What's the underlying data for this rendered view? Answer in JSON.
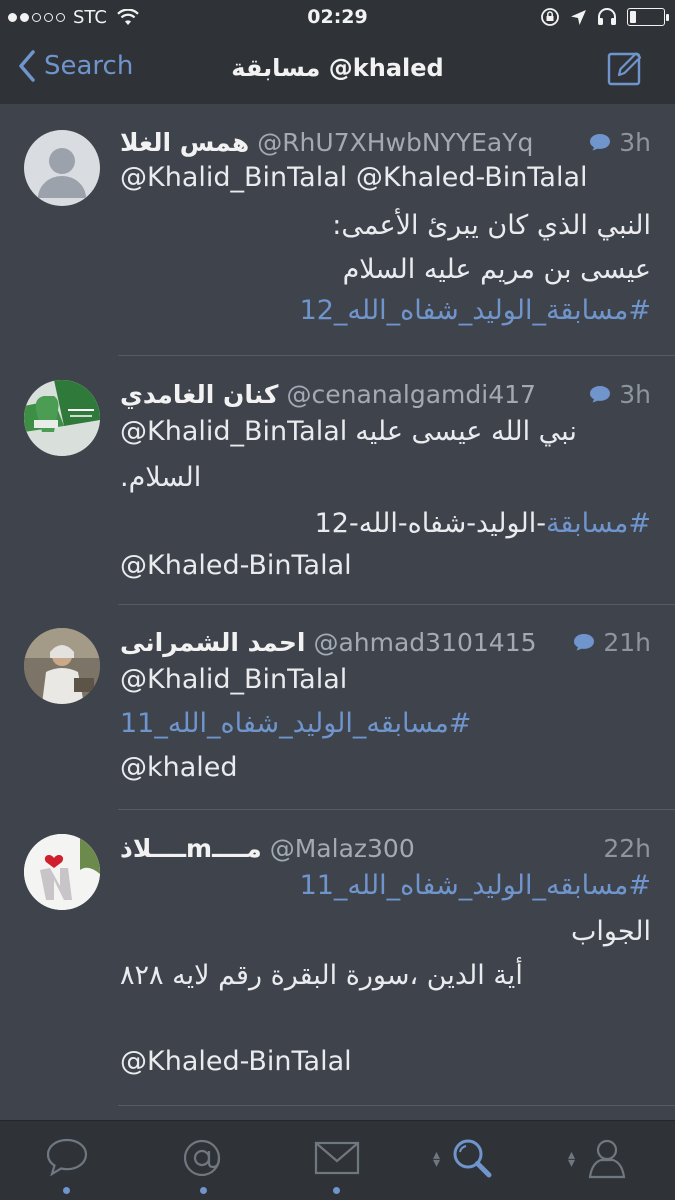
{
  "status_bar": {
    "carrier": "STC",
    "time": "02:29"
  },
  "nav": {
    "back_label": "Search",
    "title": "مسابقة @khaled"
  },
  "tweets": [
    {
      "name": "همس الغلا",
      "handle": "@RhU7XHwbNYYEaYq",
      "time": "3h",
      "mentions": "@Khalid_BinTalal @Khaled-BinTalal",
      "line1": "النبي الذي كان يبرئ الأعمى:",
      "line2": "عيسى بن مريم عليه السلام",
      "hashtag": "#مسابقة_الوليد_شفاه_الله_12"
    },
    {
      "name": "كنان الغامدي",
      "handle": "@cenanalgamdi417",
      "time": "3h",
      "mention": "@Khalid_BinTalal",
      "text1": "نبي الله عيسى عليه",
      "text2": "السلام.",
      "hashtag": "#مسابقة",
      "hashtag_rest": "-الوليد-شفاه-الله-12",
      "mention2": "@Khaled-BinTalal"
    },
    {
      "name": "احمد الشمرانى",
      "handle": "@ahmad3101415",
      "time": "21h",
      "mention": "@Khalid_BinTalal",
      "hashtag": "#مسابقه_الوليد_شفاه_الله_11",
      "mention2": "@khaled"
    },
    {
      "name": "مــــmــــلاذ",
      "handle": "@Malaz300",
      "time": "22h",
      "hashtag": "#مسابقه_الوليد_شفاه_الله_11",
      "line1": "الجواب",
      "line2": "أية الدين ،سورة البقرة رقم لايه ٨٢٨",
      "mention": "@Khaled-BinTalal"
    }
  ],
  "tabs": [
    {
      "icon": "chat-bubble-icon"
    },
    {
      "icon": "at-mention-icon"
    },
    {
      "icon": "envelope-icon"
    },
    {
      "icon": "search-icon"
    },
    {
      "icon": "profile-icon"
    }
  ],
  "colors": {
    "background": "#3f444c",
    "bar": "#2f3338",
    "accent": "#6f95cc",
    "muted": "#a3aab3"
  }
}
